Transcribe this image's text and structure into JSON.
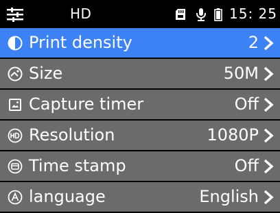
{
  "status_bar": {
    "title": "HD",
    "time": "15: 25",
    "icons": [
      "menu-icon",
      "sd-card-icon",
      "microphone-icon",
      "battery-icon"
    ]
  },
  "colors": {
    "selected_row": "#3d82f5",
    "row": "#6b6b6b",
    "background": "#000000",
    "text": "#ffffff"
  },
  "menu": {
    "items": [
      {
        "label": "Print density",
        "value": "2",
        "icon": "contrast-icon",
        "selected": true
      },
      {
        "label": "Size",
        "value": "50M",
        "icon": "size-icon",
        "selected": false
      },
      {
        "label": "Capture timer",
        "value": "Off",
        "icon": "image-timer-icon",
        "selected": false
      },
      {
        "label": "Resolution",
        "value": "1080P",
        "icon": "hd-icon",
        "selected": false
      },
      {
        "label": "Time stamp",
        "value": "Off",
        "icon": "time-stamp-icon",
        "selected": false
      },
      {
        "label": "language",
        "value": "English",
        "icon": "language-icon",
        "selected": false
      }
    ]
  }
}
